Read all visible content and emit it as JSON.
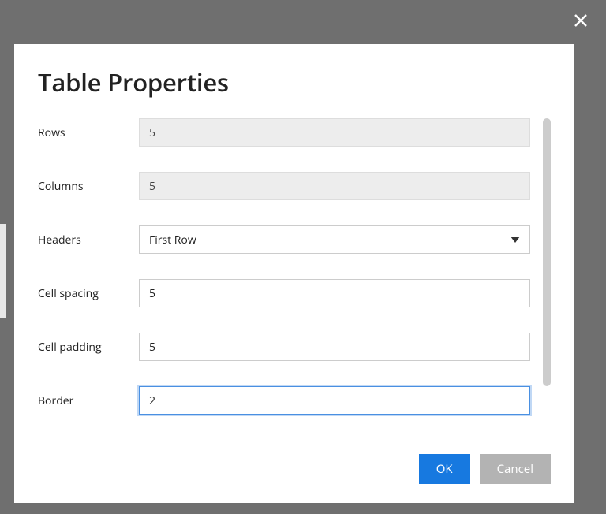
{
  "dialog": {
    "title": "Table Properties",
    "fields": {
      "rows": {
        "label": "Rows",
        "value": "5"
      },
      "columns": {
        "label": "Columns",
        "value": "5"
      },
      "headers": {
        "label": "Headers",
        "value": "First Row"
      },
      "cell_spacing": {
        "label": "Cell spacing",
        "value": "5"
      },
      "cell_padding": {
        "label": "Cell padding",
        "value": "5"
      },
      "border": {
        "label": "Border",
        "value": "2"
      }
    },
    "buttons": {
      "ok": "OK",
      "cancel": "Cancel"
    }
  }
}
